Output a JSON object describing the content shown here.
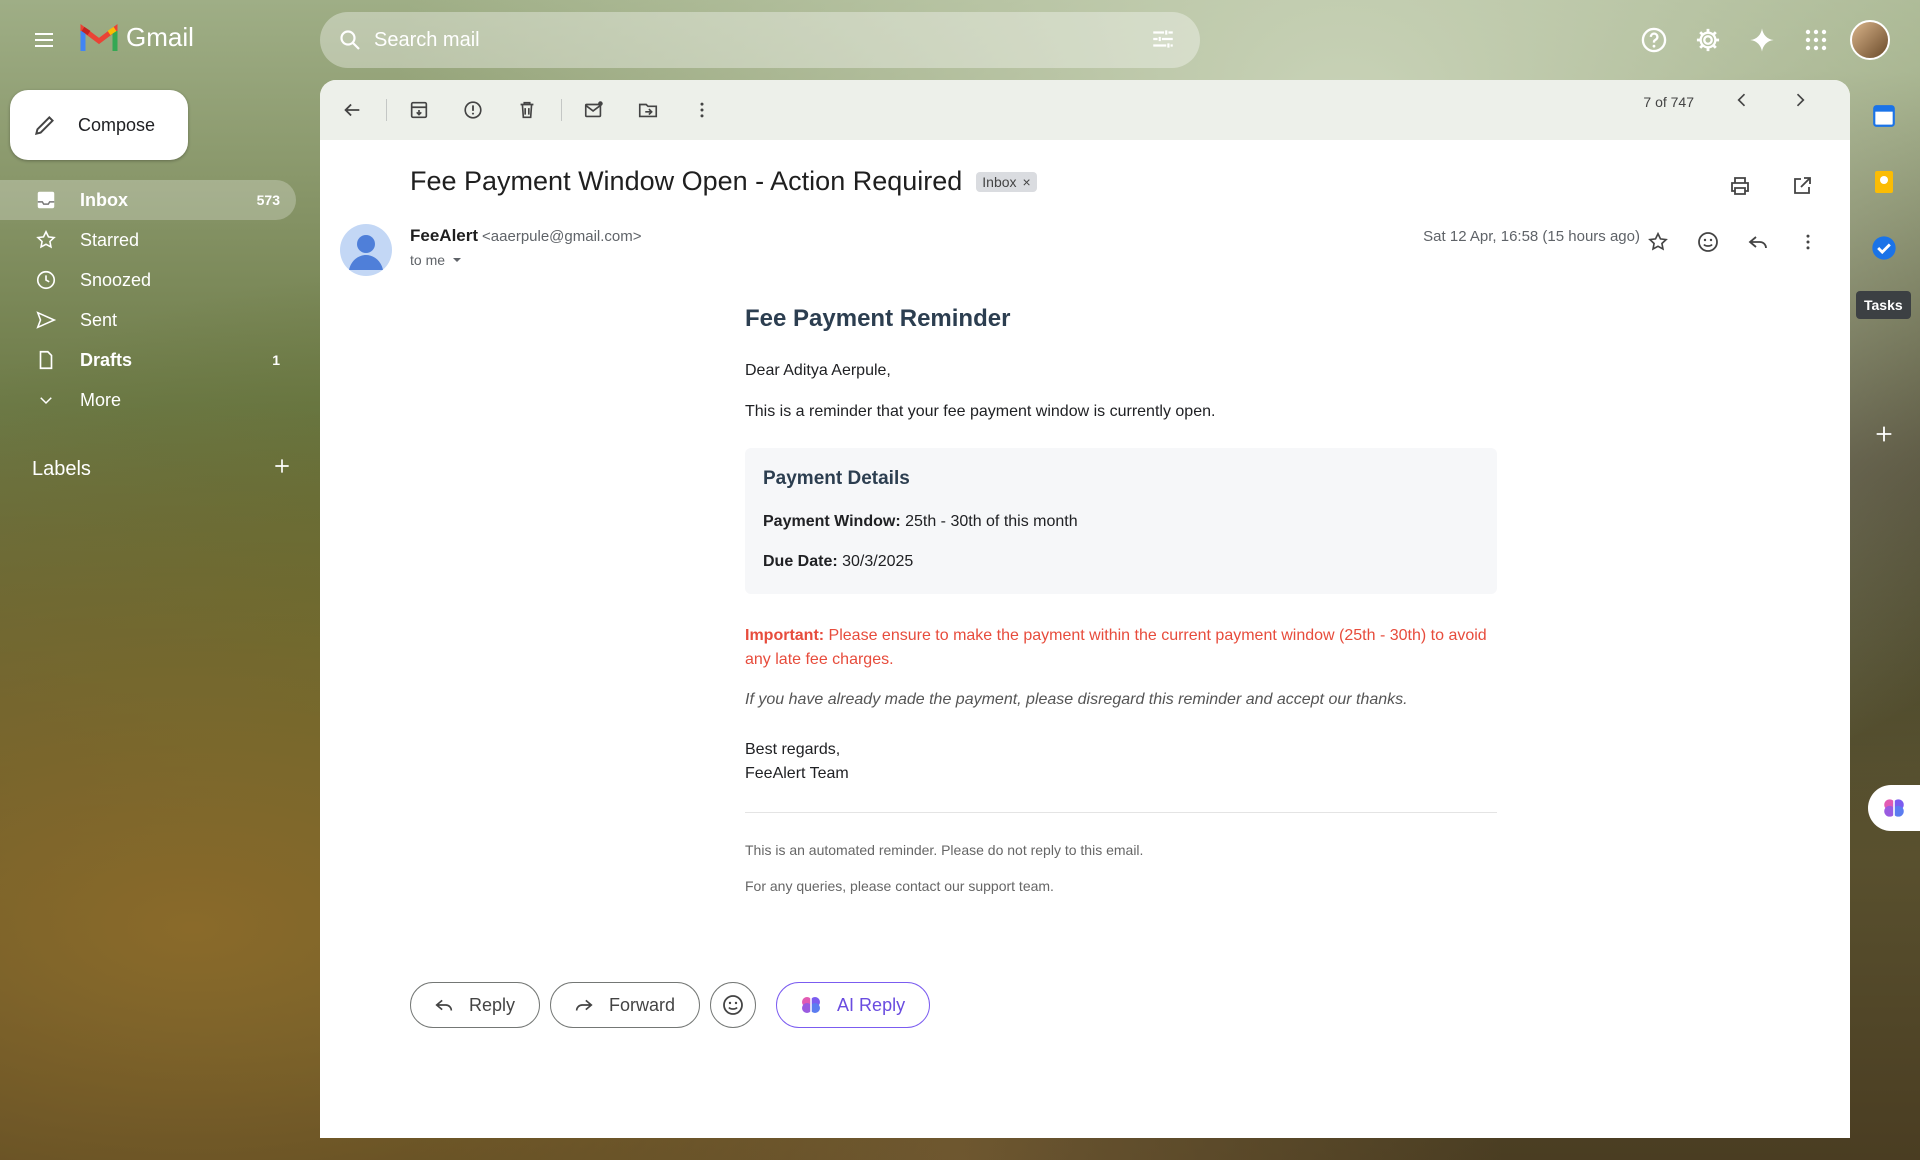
{
  "app": {
    "name": "Gmail"
  },
  "search": {
    "placeholder": "Search mail"
  },
  "compose": {
    "label": "Compose"
  },
  "sidebar": {
    "items": [
      {
        "label": "Inbox",
        "count": "573"
      },
      {
        "label": "Starred",
        "count": ""
      },
      {
        "label": "Snoozed",
        "count": ""
      },
      {
        "label": "Sent",
        "count": ""
      },
      {
        "label": "Drafts",
        "count": "1"
      },
      {
        "label": "More",
        "count": ""
      }
    ],
    "labels_title": "Labels"
  },
  "toolbar": {
    "pager": "7 of 747"
  },
  "email": {
    "subject": "Fee Payment Window Open - Action Required",
    "chip": "Inbox",
    "sender_name": "FeeAlert",
    "sender_email": "<aaerpule@gmail.com>",
    "to": "to me",
    "date": "Sat 12 Apr, 16:58 (15 hours ago)",
    "heading": "Fee Payment Reminder",
    "greeting": "Dear Aditya Aerpule,",
    "intro": "This is a reminder that your fee payment window is currently open.",
    "details_title": "Payment Details",
    "window_label": "Payment Window:",
    "window_value": " 25th - 30th of this month",
    "due_label": "Due Date:",
    "due_value": " 30/3/2025",
    "important_label": "Important:",
    "important_text": " Please ensure to make the payment within the current payment window (25th - 30th) to avoid any late fee charges.",
    "disregard": "If you have already made the payment, please disregard this reminder and accept our thanks.",
    "regards_line1": "Best regards,",
    "regards_line2": "FeeAlert Team",
    "footnote1": "This is an automated reminder. Please do not reply to this email.",
    "footnote2": "For any queries, please contact our support team."
  },
  "actions": {
    "reply": "Reply",
    "forward": "Forward",
    "ai_reply": "AI Reply"
  },
  "rail": {
    "tasks_tooltip": "Tasks",
    "calendar_day": "31"
  },
  "colors": {
    "important_red": "#e74c3c",
    "heading": "#2c3e50",
    "ai_purple": "#6a4ce0"
  }
}
